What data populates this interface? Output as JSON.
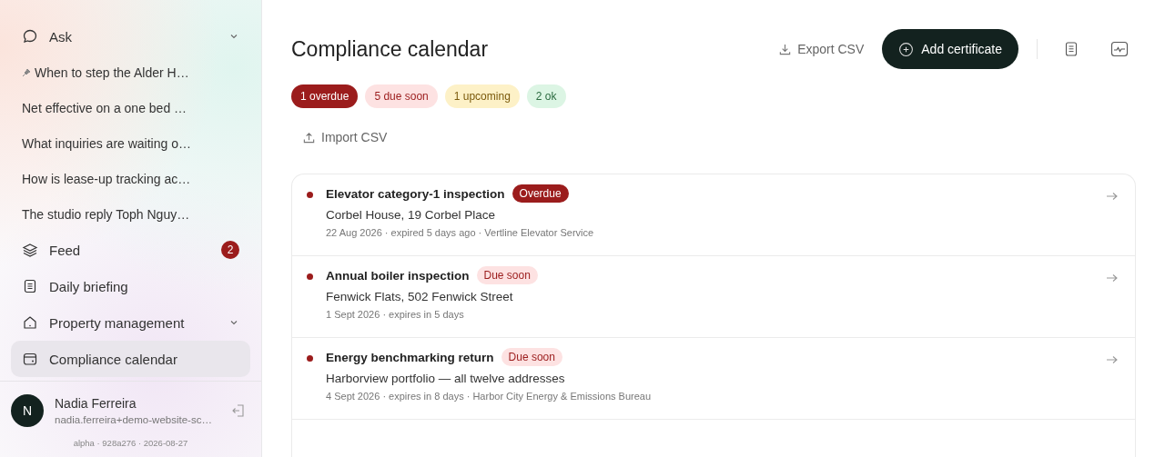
{
  "sidebar": {
    "items": [
      {
        "kind": "nav",
        "label": "Ask",
        "expanded": false,
        "selected": false
      },
      {
        "kind": "chat",
        "label": "When to step the Alder H…",
        "pinned": true
      },
      {
        "kind": "chat",
        "label": "Net effective on a one bed …",
        "pinned": false
      },
      {
        "kind": "chat",
        "label": "What inquiries are waiting o…",
        "pinned": false
      },
      {
        "kind": "chat",
        "label": "How is lease-up tracking ac…",
        "pinned": false
      },
      {
        "kind": "chat",
        "label": "The studio reply Toph Nguy…",
        "pinned": false
      },
      {
        "kind": "nav",
        "label": "Feed",
        "badge": "2",
        "selected": false
      },
      {
        "kind": "nav",
        "label": "Daily briefing",
        "selected": false
      },
      {
        "kind": "nav",
        "label": "Property management",
        "expanded": false,
        "selected": false
      },
      {
        "kind": "nav",
        "label": "Compliance calendar",
        "selected": true
      }
    ],
    "user": {
      "initial": "N",
      "name": "Nadia Ferreira",
      "email": "nadia.ferreira+demo-website-sc…"
    },
    "version": "alpha · 928a276 · 2026-08-27"
  },
  "page": {
    "title": "Compliance calendar",
    "export": "Export CSV",
    "add": "Add certificate",
    "import": "Import CSV",
    "summary": [
      {
        "label": "1 overdue",
        "kind": "overdue"
      },
      {
        "label": "5 due soon",
        "kind": "due_soon"
      },
      {
        "label": "1 upcoming",
        "kind": "upcoming"
      },
      {
        "label": "2 ok",
        "kind": "ok"
      }
    ]
  },
  "certificates": [
    {
      "title": "Elevator category-1 inspection",
      "status": "Overdue",
      "kind": "overdue",
      "property": "Corbel House, 19 Corbel Place",
      "meta": "22 Aug 2026 · expired 5 days ago · Vertline Elevator Service"
    },
    {
      "title": "Annual boiler inspection",
      "status": "Due soon",
      "kind": "due_soon",
      "property": "Fenwick Flats, 502 Fenwick Street",
      "meta": "1 Sept 2026 · expires in 5 days"
    },
    {
      "title": "Energy benchmarking return",
      "status": "Due soon",
      "kind": "due_soon",
      "property": "Harborview portfolio — all twelve addresses",
      "meta": "4 Sept 2026 · expires in 8 days · Harbor City Energy & Emissions Bureau"
    }
  ]
}
